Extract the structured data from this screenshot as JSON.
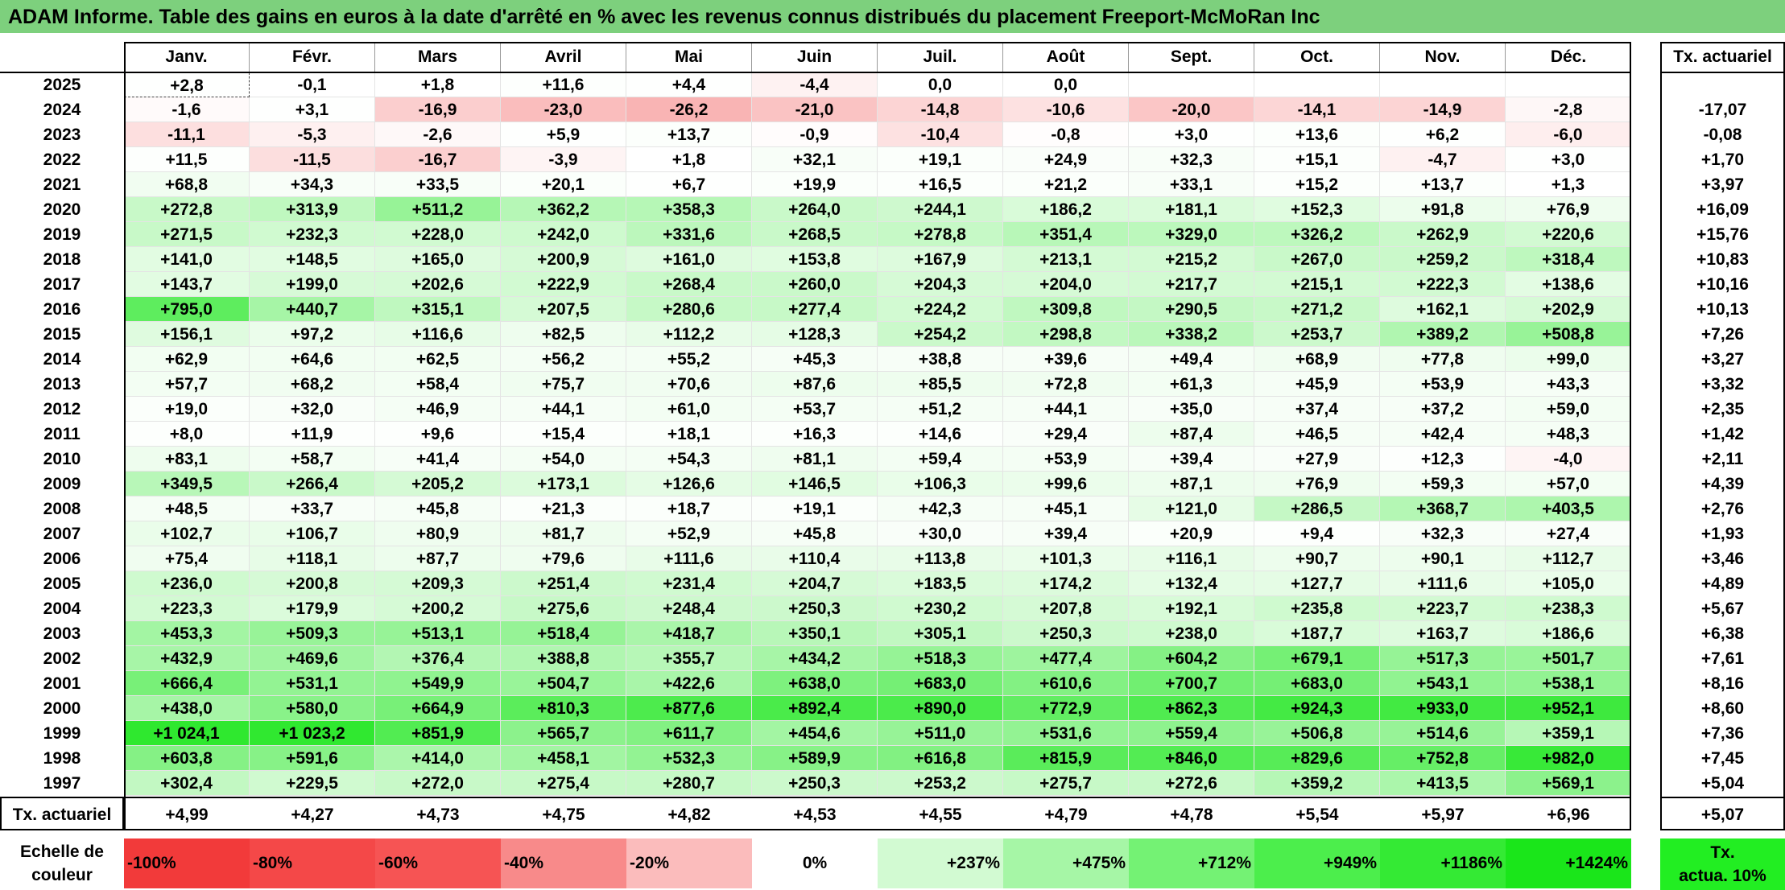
{
  "title": "ADAM Informe. Table des gains en euros à la date d'arrêté en % avec les revenus connus distribués du placement Freeport-McMoRan Inc",
  "months": [
    "Janv.",
    "Févr.",
    "Mars",
    "Avril",
    "Mai",
    "Juin",
    "Juil.",
    "Août",
    "Sept.",
    "Oct.",
    "Nov.",
    "Déc."
  ],
  "tx_header": "Tx. actuariel",
  "rows": [
    {
      "year": "2025",
      "values": [
        "+2,8",
        "-0,1",
        "+1,8",
        "+11,6",
        "+4,4",
        "-4,4",
        "0,0",
        "0,0",
        "",
        "",
        "",
        ""
      ],
      "tx": ""
    },
    {
      "year": "2024",
      "values": [
        "-1,6",
        "+3,1",
        "-16,9",
        "-23,0",
        "-26,2",
        "-21,0",
        "-14,8",
        "-10,6",
        "-20,0",
        "-14,1",
        "-14,9",
        "-2,8"
      ],
      "tx": "-17,07"
    },
    {
      "year": "2023",
      "values": [
        "-11,1",
        "-5,3",
        "-2,6",
        "+5,9",
        "+13,7",
        "-0,9",
        "-10,4",
        "-0,8",
        "+3,0",
        "+13,6",
        "+6,2",
        "-6,0"
      ],
      "tx": "-0,08"
    },
    {
      "year": "2022",
      "values": [
        "+11,5",
        "-11,5",
        "-16,7",
        "-3,9",
        "+1,8",
        "+32,1",
        "+19,1",
        "+24,9",
        "+32,3",
        "+15,1",
        "-4,7",
        "+3,0"
      ],
      "tx": "+1,70"
    },
    {
      "year": "2021",
      "values": [
        "+68,8",
        "+34,3",
        "+33,5",
        "+20,1",
        "+6,7",
        "+19,9",
        "+16,5",
        "+21,2",
        "+33,1",
        "+15,2",
        "+13,7",
        "+1,3"
      ],
      "tx": "+3,97"
    },
    {
      "year": "2020",
      "values": [
        "+272,8",
        "+313,9",
        "+511,2",
        "+362,2",
        "+358,3",
        "+264,0",
        "+244,1",
        "+186,2",
        "+181,1",
        "+152,3",
        "+91,8",
        "+76,9"
      ],
      "tx": "+16,09"
    },
    {
      "year": "2019",
      "values": [
        "+271,5",
        "+232,3",
        "+228,0",
        "+242,0",
        "+331,6",
        "+268,5",
        "+278,8",
        "+351,4",
        "+329,0",
        "+326,2",
        "+262,9",
        "+220,6"
      ],
      "tx": "+15,76"
    },
    {
      "year": "2018",
      "values": [
        "+141,0",
        "+148,5",
        "+165,0",
        "+200,9",
        "+161,0",
        "+153,8",
        "+167,9",
        "+213,1",
        "+215,2",
        "+267,0",
        "+259,2",
        "+318,4"
      ],
      "tx": "+10,83"
    },
    {
      "year": "2017",
      "values": [
        "+143,7",
        "+199,0",
        "+202,6",
        "+222,9",
        "+268,4",
        "+260,0",
        "+204,3",
        "+204,0",
        "+217,7",
        "+215,1",
        "+222,3",
        "+138,6"
      ],
      "tx": "+10,16"
    },
    {
      "year": "2016",
      "values": [
        "+795,0",
        "+440,7",
        "+315,1",
        "+207,5",
        "+280,6",
        "+277,4",
        "+224,2",
        "+309,8",
        "+290,5",
        "+271,2",
        "+162,1",
        "+202,9"
      ],
      "tx": "+10,13"
    },
    {
      "year": "2015",
      "values": [
        "+156,1",
        "+97,2",
        "+116,6",
        "+82,5",
        "+112,2",
        "+128,3",
        "+254,2",
        "+298,8",
        "+338,2",
        "+253,7",
        "+389,2",
        "+508,8"
      ],
      "tx": "+7,26"
    },
    {
      "year": "2014",
      "values": [
        "+62,9",
        "+64,6",
        "+62,5",
        "+56,2",
        "+55,2",
        "+45,3",
        "+38,8",
        "+39,6",
        "+49,4",
        "+68,9",
        "+77,8",
        "+99,0"
      ],
      "tx": "+3,27"
    },
    {
      "year": "2013",
      "values": [
        "+57,7",
        "+68,2",
        "+58,4",
        "+75,7",
        "+70,6",
        "+87,6",
        "+85,5",
        "+72,8",
        "+61,3",
        "+45,9",
        "+53,9",
        "+43,3"
      ],
      "tx": "+3,32"
    },
    {
      "year": "2012",
      "values": [
        "+19,0",
        "+32,0",
        "+46,9",
        "+44,1",
        "+61,0",
        "+53,7",
        "+51,2",
        "+44,1",
        "+35,0",
        "+37,4",
        "+37,2",
        "+59,0"
      ],
      "tx": "+2,35"
    },
    {
      "year": "2011",
      "values": [
        "+8,0",
        "+11,9",
        "+9,6",
        "+15,4",
        "+18,1",
        "+16,3",
        "+14,6",
        "+29,4",
        "+87,4",
        "+46,5",
        "+42,4",
        "+48,3"
      ],
      "tx": "+1,42"
    },
    {
      "year": "2010",
      "values": [
        "+83,1",
        "+58,7",
        "+41,4",
        "+54,0",
        "+54,3",
        "+81,1",
        "+59,4",
        "+53,9",
        "+39,4",
        "+27,9",
        "+12,3",
        "-4,0"
      ],
      "tx": "+2,11"
    },
    {
      "year": "2009",
      "values": [
        "+349,5",
        "+266,4",
        "+205,2",
        "+173,1",
        "+126,6",
        "+146,5",
        "+106,3",
        "+99,6",
        "+87,1",
        "+76,9",
        "+59,3",
        "+57,0"
      ],
      "tx": "+4,39"
    },
    {
      "year": "2008",
      "values": [
        "+48,5",
        "+33,7",
        "+45,8",
        "+21,3",
        "+18,7",
        "+19,1",
        "+42,3",
        "+45,1",
        "+121,0",
        "+286,5",
        "+368,7",
        "+403,5"
      ],
      "tx": "+2,76"
    },
    {
      "year": "2007",
      "values": [
        "+102,7",
        "+106,7",
        "+80,9",
        "+81,7",
        "+52,9",
        "+45,8",
        "+30,0",
        "+39,4",
        "+20,9",
        "+9,4",
        "+32,3",
        "+27,4"
      ],
      "tx": "+1,93"
    },
    {
      "year": "2006",
      "values": [
        "+75,4",
        "+118,1",
        "+87,7",
        "+79,6",
        "+111,6",
        "+110,4",
        "+113,8",
        "+101,3",
        "+116,1",
        "+90,7",
        "+90,1",
        "+112,7"
      ],
      "tx": "+3,46"
    },
    {
      "year": "2005",
      "values": [
        "+236,0",
        "+200,8",
        "+209,3",
        "+251,4",
        "+231,4",
        "+204,7",
        "+183,5",
        "+174,2",
        "+132,4",
        "+127,7",
        "+111,6",
        "+105,0"
      ],
      "tx": "+4,89"
    },
    {
      "year": "2004",
      "values": [
        "+223,3",
        "+179,9",
        "+200,2",
        "+275,6",
        "+248,4",
        "+250,3",
        "+230,2",
        "+207,8",
        "+192,1",
        "+235,8",
        "+223,7",
        "+238,3"
      ],
      "tx": "+5,67"
    },
    {
      "year": "2003",
      "values": [
        "+453,3",
        "+509,3",
        "+513,1",
        "+518,4",
        "+418,7",
        "+350,1",
        "+305,1",
        "+250,3",
        "+238,0",
        "+187,7",
        "+163,7",
        "+186,6"
      ],
      "tx": "+6,38"
    },
    {
      "year": "2002",
      "values": [
        "+432,9",
        "+469,6",
        "+376,4",
        "+388,8",
        "+355,7",
        "+434,2",
        "+518,3",
        "+477,4",
        "+604,2",
        "+679,1",
        "+517,3",
        "+501,7"
      ],
      "tx": "+7,61"
    },
    {
      "year": "2001",
      "values": [
        "+666,4",
        "+531,1",
        "+549,9",
        "+504,7",
        "+422,6",
        "+638,0",
        "+683,0",
        "+610,6",
        "+700,7",
        "+683,0",
        "+543,1",
        "+538,1"
      ],
      "tx": "+8,16"
    },
    {
      "year": "2000",
      "values": [
        "+438,0",
        "+580,0",
        "+664,9",
        "+810,3",
        "+877,6",
        "+892,4",
        "+890,0",
        "+772,9",
        "+862,3",
        "+924,3",
        "+933,0",
        "+952,1"
      ],
      "tx": "+8,60"
    },
    {
      "year": "1999",
      "values": [
        "+1 024,1",
        "+1 023,2",
        "+851,9",
        "+565,7",
        "+611,7",
        "+454,6",
        "+511,0",
        "+531,6",
        "+559,4",
        "+506,8",
        "+514,6",
        "+359,1"
      ],
      "tx": "+7,36"
    },
    {
      "year": "1998",
      "values": [
        "+603,8",
        "+591,6",
        "+414,0",
        "+458,1",
        "+532,3",
        "+589,9",
        "+616,8",
        "+815,9",
        "+846,0",
        "+829,6",
        "+752,8",
        "+982,0"
      ],
      "tx": "+7,45"
    },
    {
      "year": "1997",
      "values": [
        "+302,4",
        "+229,5",
        "+272,0",
        "+275,4",
        "+280,7",
        "+250,3",
        "+253,2",
        "+275,7",
        "+272,6",
        "+359,2",
        "+413,5",
        "+569,1"
      ],
      "tx": "+5,04"
    }
  ],
  "summary": {
    "label": "Tx. actuariel",
    "values": [
      "+4,99",
      "+4,27",
      "+4,73",
      "+4,75",
      "+4,82",
      "+4,53",
      "+4,55",
      "+4,79",
      "+4,78",
      "+5,54",
      "+5,97",
      "+6,96"
    ],
    "tx": "+5,07"
  },
  "scale": {
    "label_line1": "Echelle de",
    "label_line2": "couleur",
    "items": [
      {
        "label": "-100%",
        "color": "#f23a3a"
      },
      {
        "label": "-80%",
        "color": "#f44848"
      },
      {
        "label": "-60%",
        "color": "#f65454"
      },
      {
        "label": "-40%",
        "color": "#f88a8a"
      },
      {
        "label": "-20%",
        "color": "#fbbcbc"
      },
      {
        "label": "0%",
        "color": "#ffffff"
      },
      {
        "label": "+237%",
        "color": "#d2fad2"
      },
      {
        "label": "+475%",
        "color": "#a6f6a6"
      },
      {
        "label": "+712%",
        "color": "#74f274"
      },
      {
        "label": "+949%",
        "color": "#4cee4c"
      },
      {
        "label": "+1186%",
        "color": "#34ea34"
      },
      {
        "label": "+1424%",
        "color": "#1ae61a"
      }
    ],
    "tx_line1": "Tx.",
    "tx_line2": "actua. 10%",
    "tx_color": "#22ee22"
  }
}
